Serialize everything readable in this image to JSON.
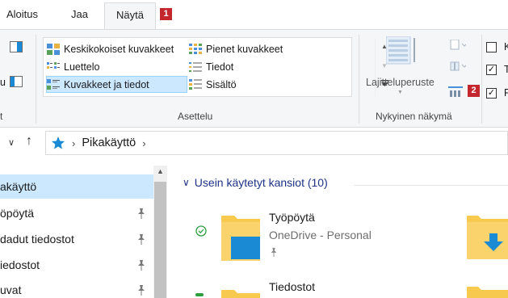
{
  "tabs": {
    "start": "Aloitus",
    "share": "Jaa",
    "view": "Näytä"
  },
  "badges": {
    "one": "1",
    "two": "2"
  },
  "ribbon": {
    "layout": {
      "medium_icons": "Keskikokoiset kuvakkeet",
      "small_icons": "Pienet kuvakkeet",
      "list": "Luettelo",
      "details": "Tiedot",
      "tiles": "Kuvakkeet ja tiedot",
      "content": "Sisältö",
      "group_label": "Asettelu"
    },
    "current_view": {
      "sort_by": "Lajitteluperuste",
      "group_label": "Nykyinen näkymä"
    },
    "left_partial": {
      "label_u": "u",
      "label_t": "t"
    },
    "right_partial": {
      "k": "K",
      "t": "T",
      "p": "P"
    }
  },
  "address": {
    "location": "Pikakäyttö"
  },
  "navpane": {
    "items": [
      {
        "label": "akäyttö",
        "selected": true,
        "pinned": false
      },
      {
        "label": "öpöytä",
        "selected": false,
        "pinned": true
      },
      {
        "label": "dadut tiedostot",
        "selected": false,
        "pinned": true
      },
      {
        "label": "iedostot",
        "selected": false,
        "pinned": true
      },
      {
        "label": "uvat",
        "selected": false,
        "pinned": true
      }
    ]
  },
  "content": {
    "section_header": "Usein käytetyt kansiot (10)",
    "folders": [
      {
        "title": "Työpöytä",
        "subtitle": "OneDrive - Personal"
      },
      {
        "title": "Tiedostot"
      }
    ]
  },
  "colors": {
    "ribbon_bg": "#f5f6f7",
    "selection": "#cce8ff",
    "badge": "#c4262e",
    "folder_yellow": "#f8c94f",
    "link_blue": "#1e3287",
    "accent_blue": "#1a8ad4",
    "sync_green": "#2e9e3e"
  }
}
